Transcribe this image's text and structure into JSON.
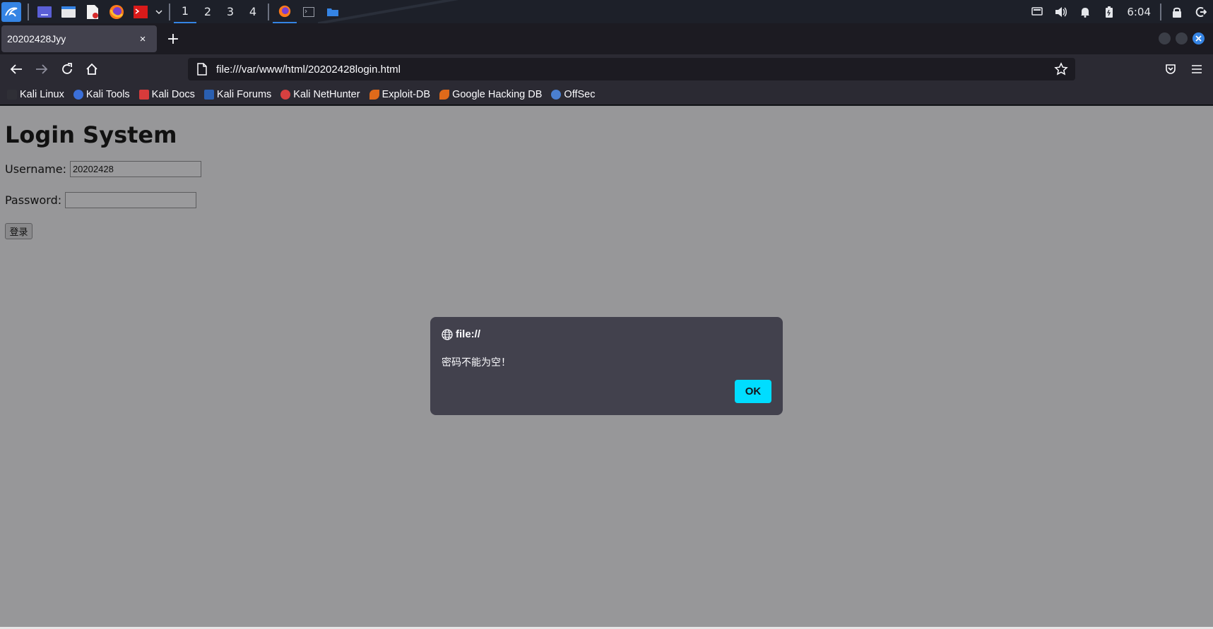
{
  "taskbar": {
    "workspaces": [
      "1",
      "2",
      "3",
      "4"
    ],
    "active_workspace": "1",
    "clock": "6:04"
  },
  "browser": {
    "tab_title": "20202428Jyy",
    "close_glyph": "×",
    "new_tab_glyph": "+",
    "url": "file:///var/www/html/20202428login.html"
  },
  "bookmarks": [
    {
      "label": "Kali Linux",
      "color": "#2f2f36"
    },
    {
      "label": "Kali Tools",
      "color": "#3b6fd8"
    },
    {
      "label": "Kali Docs",
      "color": "#d83b3b"
    },
    {
      "label": "Kali Forums",
      "color": "#2a5fb0"
    },
    {
      "label": "Kali NetHunter",
      "color": "#d84040"
    },
    {
      "label": "Exploit-DB",
      "color": "#e06a1a"
    },
    {
      "label": "Google Hacking DB",
      "color": "#e06a1a"
    },
    {
      "label": "OffSec",
      "color": "#4a7fd0"
    }
  ],
  "page": {
    "heading": "Login System",
    "username_label": "Username:",
    "username_value": "20202428",
    "password_label": "Password:",
    "password_value": "",
    "submit_label": "登录"
  },
  "dialog": {
    "origin": "file://",
    "message": "密码不能为空！",
    "ok_label": "OK"
  },
  "colors": {
    "accent": "#3584e4",
    "dialog_button": "#00ddff",
    "page_overlay": "#979799"
  }
}
